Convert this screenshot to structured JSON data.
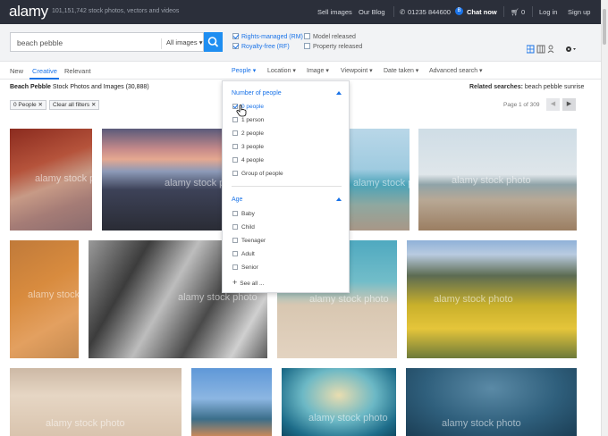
{
  "header": {
    "logo": "alamy",
    "tagline": "101,151,742  stock photos, vectors and videos",
    "links": {
      "sell": "Sell images",
      "blog": "Our Blog",
      "phone": "01235 844600",
      "chat": "Chat now",
      "cart": "0",
      "login": "Log in",
      "signup": "Sign up"
    }
  },
  "search": {
    "query": "beach pebble",
    "type_selected": "All images",
    "rights_managed": "Rights-managed (RM)",
    "royalty_free": "Royalty-free (RF)",
    "model_released": "Model released",
    "property_released": "Property released"
  },
  "tabs": [
    "New",
    "Creative",
    "Relevant"
  ],
  "filters": [
    "People",
    "Location",
    "Image",
    "Viewpoint",
    "Date taken",
    "Advanced search"
  ],
  "results": {
    "title_bold": "Beach Pebble",
    "title_rest": " Stock Photos and Images (30,888)",
    "related_label": "Related searches:",
    "related_value": " beach pebble sunrise",
    "chip_people": "0 People",
    "chip_clear": "Clear all filters",
    "pager": "Page 1 of 309"
  },
  "dropdown": {
    "number_heading": "Number of people",
    "number_options": [
      "0 people",
      "1 person",
      "2 people",
      "3 people",
      "4 people",
      "Group of people"
    ],
    "age_heading": "Age",
    "age_options": [
      "Baby",
      "Child",
      "Teenager",
      "Adult",
      "Senior"
    ],
    "see_all": "See all ..."
  },
  "watermark": "alamy stock photo"
}
